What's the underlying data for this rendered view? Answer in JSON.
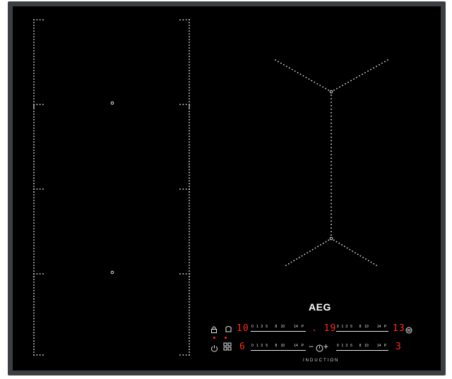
{
  "brand": "AEG",
  "footer_label": "INDUCTION",
  "colors": {
    "glass": "#000000",
    "frame": "#3b3f44",
    "display": "#ff2a1a",
    "print": "#e8e8e8"
  },
  "controls": {
    "top_left": {
      "icons": [
        "lock-icon",
        "chef-hat-icon"
      ],
      "level": "10",
      "scale": [
        "0",
        "1",
        "3",
        "5",
        "8",
        "10",
        "14",
        "P"
      ]
    },
    "top_right": {
      "timer": ". 19",
      "level": "13",
      "scale": [
        "0",
        "1",
        "3",
        "5",
        "8",
        "10",
        "14",
        "P"
      ],
      "icon": "ventilation-icon"
    },
    "bottom_left": {
      "icons": [
        "power-icon",
        "bridge-icon"
      ],
      "level": "6",
      "scale": [
        "0",
        "1",
        "3",
        "5",
        "8",
        "10",
        "14",
        "P"
      ]
    },
    "bottom_right": {
      "timer_controls": [
        "−",
        "+"
      ],
      "timer_icon": "timer-icon",
      "level": "3",
      "scale": [
        "0",
        "1",
        "3",
        "5",
        "8",
        "10",
        "14",
        "P"
      ]
    }
  }
}
